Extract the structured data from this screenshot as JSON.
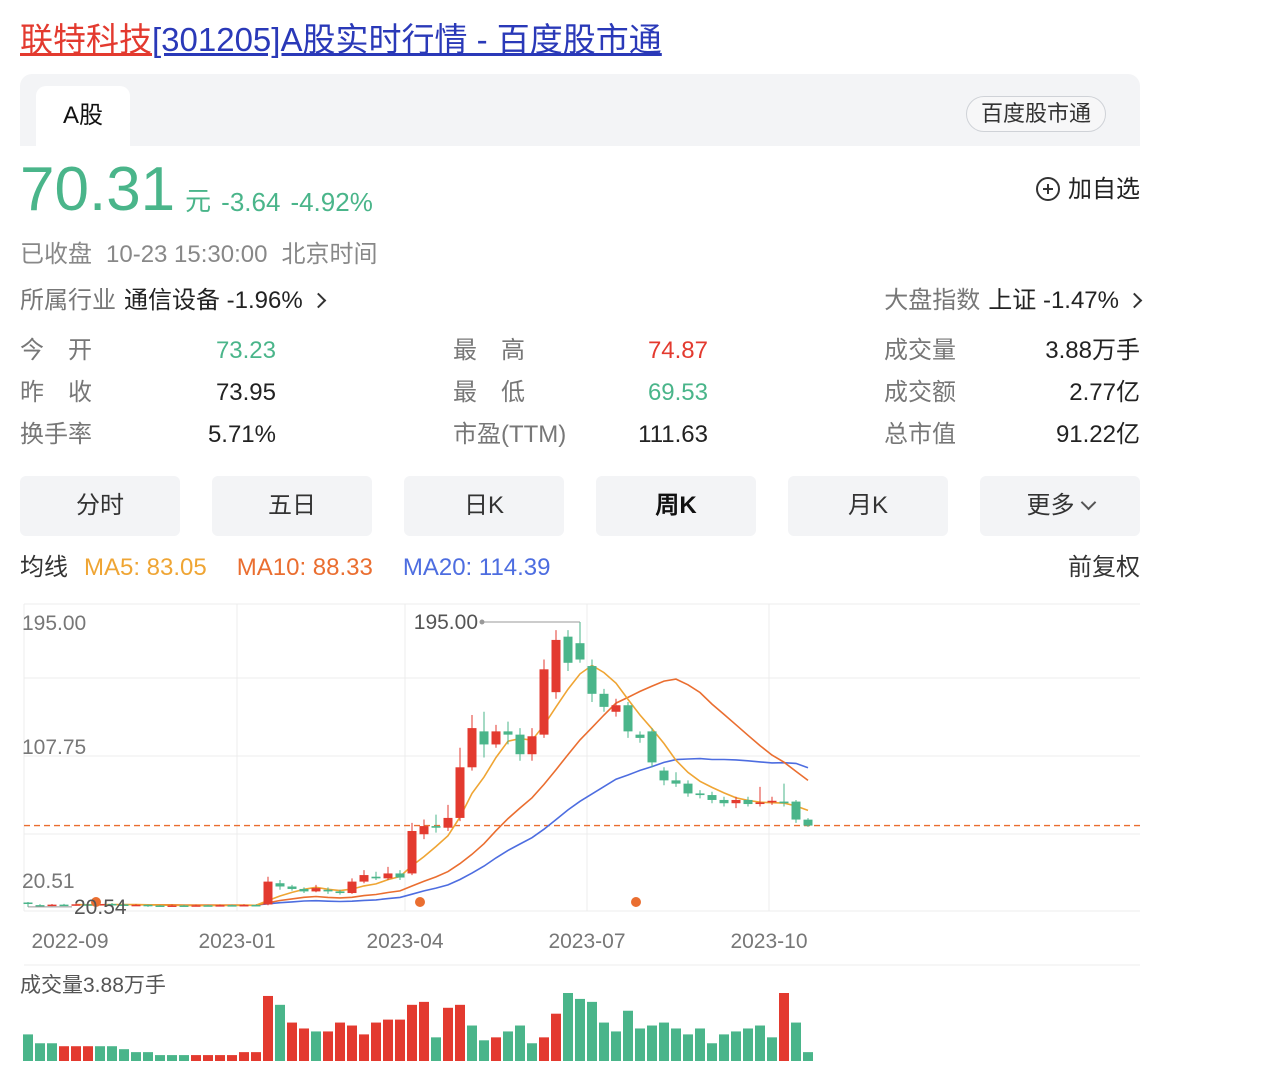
{
  "page": {
    "title_name": "联特科技",
    "title_rest": "[301205]A股实时行情 - 百度股市通"
  },
  "tabs": {
    "active": "A股",
    "source": "百度股市通"
  },
  "quote": {
    "price": "70.31",
    "unit": "元",
    "change": "-3.64",
    "change_pct": "-4.92%",
    "watch_label": "加自选"
  },
  "status": {
    "state": "已收盘",
    "time": "10-23 15:30:00",
    "tz": "北京时间"
  },
  "industry": {
    "label": "所属行业",
    "value": "通信设备 -1.96%"
  },
  "market": {
    "label": "大盘指数",
    "value": "上证 -1.47%"
  },
  "stats": [
    [
      {
        "label": "今　开",
        "value": "73.23",
        "tone": "down"
      },
      {
        "label": "最　高",
        "value": "74.87",
        "tone": "up"
      },
      {
        "label": "成交量",
        "value": "3.88万手",
        "tone": ""
      }
    ],
    [
      {
        "label": "昨　收",
        "value": "73.95",
        "tone": ""
      },
      {
        "label": "最　低",
        "value": "69.53",
        "tone": "down"
      },
      {
        "label": "成交额",
        "value": "2.77亿",
        "tone": ""
      }
    ],
    [
      {
        "label": "换手率",
        "value": "5.71%",
        "tone": ""
      },
      {
        "label": "市盈(TTM)",
        "value": "111.63",
        "tone": ""
      },
      {
        "label": "总市值",
        "value": "91.22亿",
        "tone": ""
      }
    ]
  ],
  "period_tabs": [
    "分时",
    "五日",
    "日K",
    "周K",
    "月K",
    "更多"
  ],
  "active_period": "周K",
  "ma": {
    "label": "均线",
    "ma5": "MA5: 83.05",
    "ma10": "MA10: 88.33",
    "ma20": "MA20: 114.39",
    "adjust": "前复权"
  },
  "colors": {
    "up": "#e33a2f",
    "down": "#4ab58a",
    "ma5": "#efa534",
    "ma10": "#ea6e30",
    "ma20": "#4d6de0"
  },
  "chart_data": {
    "type": "candlestick",
    "period": "weekly",
    "y_ticks": [
      "195.00",
      "107.75",
      "20.51"
    ],
    "x_ticks": [
      {
        "label": "2022-09",
        "index": 0
      },
      {
        "label": "2023-01",
        "index": 17
      },
      {
        "label": "2023-04",
        "index": 31
      },
      {
        "label": "2023-07",
        "index": 46
      },
      {
        "label": "2023-10",
        "index": 61
      }
    ],
    "max_label": "195.00",
    "min_label": "20.54",
    "last_price": 70.31,
    "ylim": [
      18,
      206
    ],
    "candles": [
      [
        22.8,
        23.2,
        23.5,
        20.5,
        "down"
      ],
      [
        21.6,
        21.2,
        22.2,
        20.8,
        "down"
      ],
      [
        21.3,
        21.9,
        22.3,
        21.0,
        "up"
      ],
      [
        21.9,
        21.5,
        22.4,
        21.1,
        "down"
      ],
      [
        21.5,
        22.1,
        22.6,
        21.2,
        "up"
      ],
      [
        22.1,
        21.7,
        22.5,
        21.3,
        "down"
      ],
      [
        21.7,
        22.3,
        22.8,
        21.4,
        "up"
      ],
      [
        22.3,
        22.0,
        22.9,
        21.6,
        "down"
      ],
      [
        22.0,
        21.6,
        22.4,
        21.2,
        "down"
      ],
      [
        21.6,
        21.8,
        22.2,
        21.3,
        "up"
      ],
      [
        21.8,
        21.4,
        22.0,
        20.54,
        "down"
      ],
      [
        21.4,
        21.1,
        21.7,
        20.8,
        "down"
      ],
      [
        21.1,
        21.4,
        21.9,
        20.9,
        "up"
      ],
      [
        21.4,
        21.2,
        21.8,
        20.9,
        "down"
      ],
      [
        21.2,
        21.5,
        21.9,
        20.9,
        "up"
      ],
      [
        21.5,
        21.3,
        21.8,
        21.0,
        "down"
      ],
      [
        21.3,
        21.6,
        22.0,
        21.0,
        "up"
      ],
      [
        21.6,
        21.4,
        21.9,
        21.1,
        "down"
      ],
      [
        21.4,
        21.7,
        22.1,
        21.1,
        "up"
      ],
      [
        21.7,
        21.5,
        22.0,
        21.2,
        "down"
      ],
      [
        22.0,
        36.0,
        39.0,
        21.5,
        "up"
      ],
      [
        35.0,
        33.0,
        37.0,
        31.0,
        "down"
      ],
      [
        33.0,
        31.5,
        34.0,
        30.5,
        "down"
      ],
      [
        31.5,
        30.0,
        32.5,
        29.0,
        "down"
      ],
      [
        30.0,
        32.0,
        34.0,
        29.5,
        "up"
      ],
      [
        31.0,
        30.0,
        32.5,
        28.5,
        "down"
      ],
      [
        30.0,
        29.0,
        31.0,
        28.0,
        "down"
      ],
      [
        29.0,
        36.0,
        38.0,
        28.5,
        "up"
      ],
      [
        36.0,
        40.0,
        43.0,
        35.0,
        "up"
      ],
      [
        39.0,
        38.0,
        42.0,
        37.0,
        "down"
      ],
      [
        38.0,
        41.0,
        45.0,
        37.0,
        "up"
      ],
      [
        41.0,
        38.5,
        43.0,
        37.0,
        "down"
      ],
      [
        41.0,
        67.0,
        72.0,
        40.0,
        "up"
      ],
      [
        65.0,
        70.0,
        74.0,
        62.0,
        "up"
      ],
      [
        70.0,
        69.0,
        77.0,
        66.0,
        "down"
      ],
      [
        69.0,
        75.0,
        83.0,
        67.0,
        "up"
      ],
      [
        75.0,
        106.0,
        118.0,
        73.0,
        "up"
      ],
      [
        106.0,
        130.0,
        138.0,
        104.0,
        "up"
      ],
      [
        128.0,
        120.0,
        140.0,
        112.0,
        "down"
      ],
      [
        120.0,
        128.0,
        132.0,
        118.0,
        "up"
      ],
      [
        128.0,
        126.0,
        134.0,
        120.0,
        "down"
      ],
      [
        126.0,
        114.0,
        130.0,
        110.0,
        "down"
      ],
      [
        114.0,
        125.0,
        130.0,
        110.0,
        "up"
      ],
      [
        126.0,
        166.0,
        172.0,
        124.0,
        "up"
      ],
      [
        152.0,
        184.0,
        190.0,
        148.0,
        "up"
      ],
      [
        186.0,
        170.0,
        190.0,
        165.0,
        "down"
      ],
      [
        182.0,
        172.0,
        195.0,
        170.0,
        "down"
      ],
      [
        168.0,
        151.0,
        172.0,
        146.0,
        "down"
      ],
      [
        151.0,
        143.0,
        154.0,
        140.0,
        "down"
      ],
      [
        140.0,
        144.0,
        148.0,
        137.0,
        "up"
      ],
      [
        144.0,
        128.0,
        146.0,
        124.0,
        "down"
      ],
      [
        126.0,
        124.0,
        128.0,
        121.0,
        "down"
      ],
      [
        128.0,
        109.0,
        130.0,
        106.0,
        "down"
      ],
      [
        104.0,
        98.0,
        106.0,
        95.0,
        "down"
      ],
      [
        98.0,
        96.0,
        103.0,
        94.0,
        "down"
      ],
      [
        96.0,
        90.0,
        98.0,
        88.0,
        "down"
      ],
      [
        90.0,
        89.0,
        92.0,
        87.0,
        "down"
      ],
      [
        89.0,
        86.0,
        91.0,
        84.0,
        "down"
      ],
      [
        86.0,
        84.0,
        88.0,
        82.0,
        "down"
      ],
      [
        84.0,
        86.0,
        88.0,
        81.0,
        "up"
      ],
      [
        86.0,
        83.5,
        88.0,
        82.0,
        "down"
      ],
      [
        83.5,
        84.5,
        94.0,
        82.0,
        "up"
      ],
      [
        84.5,
        85.5,
        88.0,
        83.0,
        "up"
      ],
      [
        85.0,
        84.0,
        96.0,
        82.0,
        "down"
      ],
      [
        85.0,
        74.0,
        86.0,
        72.0,
        "down"
      ],
      [
        73.95,
        70.31,
        74.87,
        69.53,
        "down"
      ]
    ],
    "ma5": [
      null,
      null,
      null,
      null,
      21.9,
      21.8,
      21.8,
      21.9,
      21.9,
      21.9,
      21.8,
      21.6,
      21.5,
      21.4,
      21.3,
      21.3,
      21.4,
      21.4,
      21.5,
      21.5,
      24.4,
      27.2,
      29.4,
      31.3,
      32.5,
      31.3,
      30.5,
      31.4,
      33.4,
      34.6,
      37.2,
      39.1,
      45.7,
      51.3,
      57.5,
      64.1,
      75.5,
      90.0,
      100.0,
      112.0,
      122.0,
      123.6,
      122.6,
      131.8,
      143.0,
      153.8,
      163.2,
      168.4,
      164.0,
      157.5,
      147.6,
      138.0,
      129.6,
      120.6,
      110.3,
      102.9,
      97.4,
      93.7,
      90.3,
      87.3,
      85.7,
      84.6,
      84.3,
      84.1,
      82.3,
      79.6
    ],
    "ma10": [
      null,
      null,
      null,
      null,
      null,
      null,
      null,
      null,
      null,
      21.8,
      21.8,
      21.8,
      21.8,
      21.7,
      21.6,
      21.6,
      21.6,
      21.6,
      21.6,
      21.5,
      23.0,
      24.4,
      25.4,
      26.4,
      26.9,
      26.3,
      26.0,
      26.4,
      27.4,
      28.1,
      29.3,
      30.3,
      33.3,
      36.2,
      38.9,
      42.1,
      47.0,
      52.7,
      59.2,
      67.2,
      74.6,
      81.1,
      87.3,
      95.5,
      104.5,
      113.8,
      122.8,
      130.3,
      138.0,
      145.3,
      148.8,
      152.5,
      155.7,
      158.8,
      160.0,
      156.5,
      151.8,
      144.7,
      138.4,
      132.0,
      125.6,
      119.3,
      113.5,
      109.1,
      103.5,
      98.0
    ],
    "ma20": [
      null,
      null,
      null,
      null,
      null,
      null,
      null,
      null,
      null,
      null,
      null,
      null,
      null,
      null,
      null,
      null,
      null,
      null,
      null,
      21.7,
      22.4,
      23.1,
      23.6,
      24.1,
      24.3,
      24.0,
      23.8,
      24.0,
      24.5,
      24.8,
      25.6,
      26.3,
      28.3,
      30.3,
      32.0,
      34.0,
      37.3,
      41.2,
      45.5,
      50.5,
      55.1,
      59.0,
      62.9,
      68.1,
      74.0,
      79.9,
      85.2,
      89.7,
      94.2,
      98.7,
      101.3,
      104.1,
      106.4,
      109.0,
      110.7,
      111.1,
      111.3,
      110.8,
      110.8,
      110.5,
      110.0,
      109.3,
      108.7,
      108.8,
      108.4,
      105.7
    ],
    "markers": [
      4,
      31,
      49
    ],
    "volume_label": "成交量3.88万手",
    "volumes": [
      [
        9,
        "down"
      ],
      [
        6,
        "down"
      ],
      [
        6,
        "down"
      ],
      [
        5,
        "up"
      ],
      [
        5,
        "up"
      ],
      [
        5,
        "up"
      ],
      [
        5,
        "down"
      ],
      [
        5,
        "down"
      ],
      [
        4,
        "down"
      ],
      [
        3,
        "down"
      ],
      [
        3,
        "down"
      ],
      [
        2,
        "down"
      ],
      [
        2,
        "down"
      ],
      [
        2,
        "down"
      ],
      [
        2,
        "up"
      ],
      [
        2,
        "up"
      ],
      [
        2,
        "up"
      ],
      [
        2,
        "up"
      ],
      [
        3,
        "up"
      ],
      [
        3,
        "up"
      ],
      [
        22,
        "up"
      ],
      [
        19,
        "down"
      ],
      [
        13,
        "up"
      ],
      [
        11,
        "up"
      ],
      [
        10,
        "down"
      ],
      [
        10,
        "up"
      ],
      [
        13,
        "up"
      ],
      [
        12,
        "up"
      ],
      [
        9,
        "up"
      ],
      [
        13,
        "up"
      ],
      [
        14,
        "up"
      ],
      [
        14,
        "up"
      ],
      [
        19,
        "up"
      ],
      [
        20,
        "up"
      ],
      [
        8,
        "down"
      ],
      [
        18,
        "up"
      ],
      [
        19,
        "up"
      ],
      [
        12,
        "down"
      ],
      [
        7,
        "down"
      ],
      [
        8,
        "up"
      ],
      [
        10,
        "down"
      ],
      [
        12,
        "down"
      ],
      [
        6,
        "down"
      ],
      [
        8,
        "up"
      ],
      [
        16,
        "up"
      ],
      [
        23,
        "down"
      ],
      [
        21,
        "down"
      ],
      [
        20,
        "down"
      ],
      [
        13,
        "down"
      ],
      [
        10,
        "down"
      ],
      [
        17,
        "down"
      ],
      [
        11,
        "down"
      ],
      [
        12,
        "down"
      ],
      [
        13,
        "down"
      ],
      [
        11,
        "down"
      ],
      [
        9,
        "down"
      ],
      [
        11,
        "down"
      ],
      [
        6,
        "down"
      ],
      [
        9,
        "down"
      ],
      [
        10,
        "down"
      ],
      [
        11,
        "down"
      ],
      [
        12,
        "down"
      ],
      [
        8,
        "down"
      ],
      [
        23,
        "up"
      ],
      [
        13,
        "down"
      ],
      [
        3,
        "down"
      ]
    ]
  }
}
